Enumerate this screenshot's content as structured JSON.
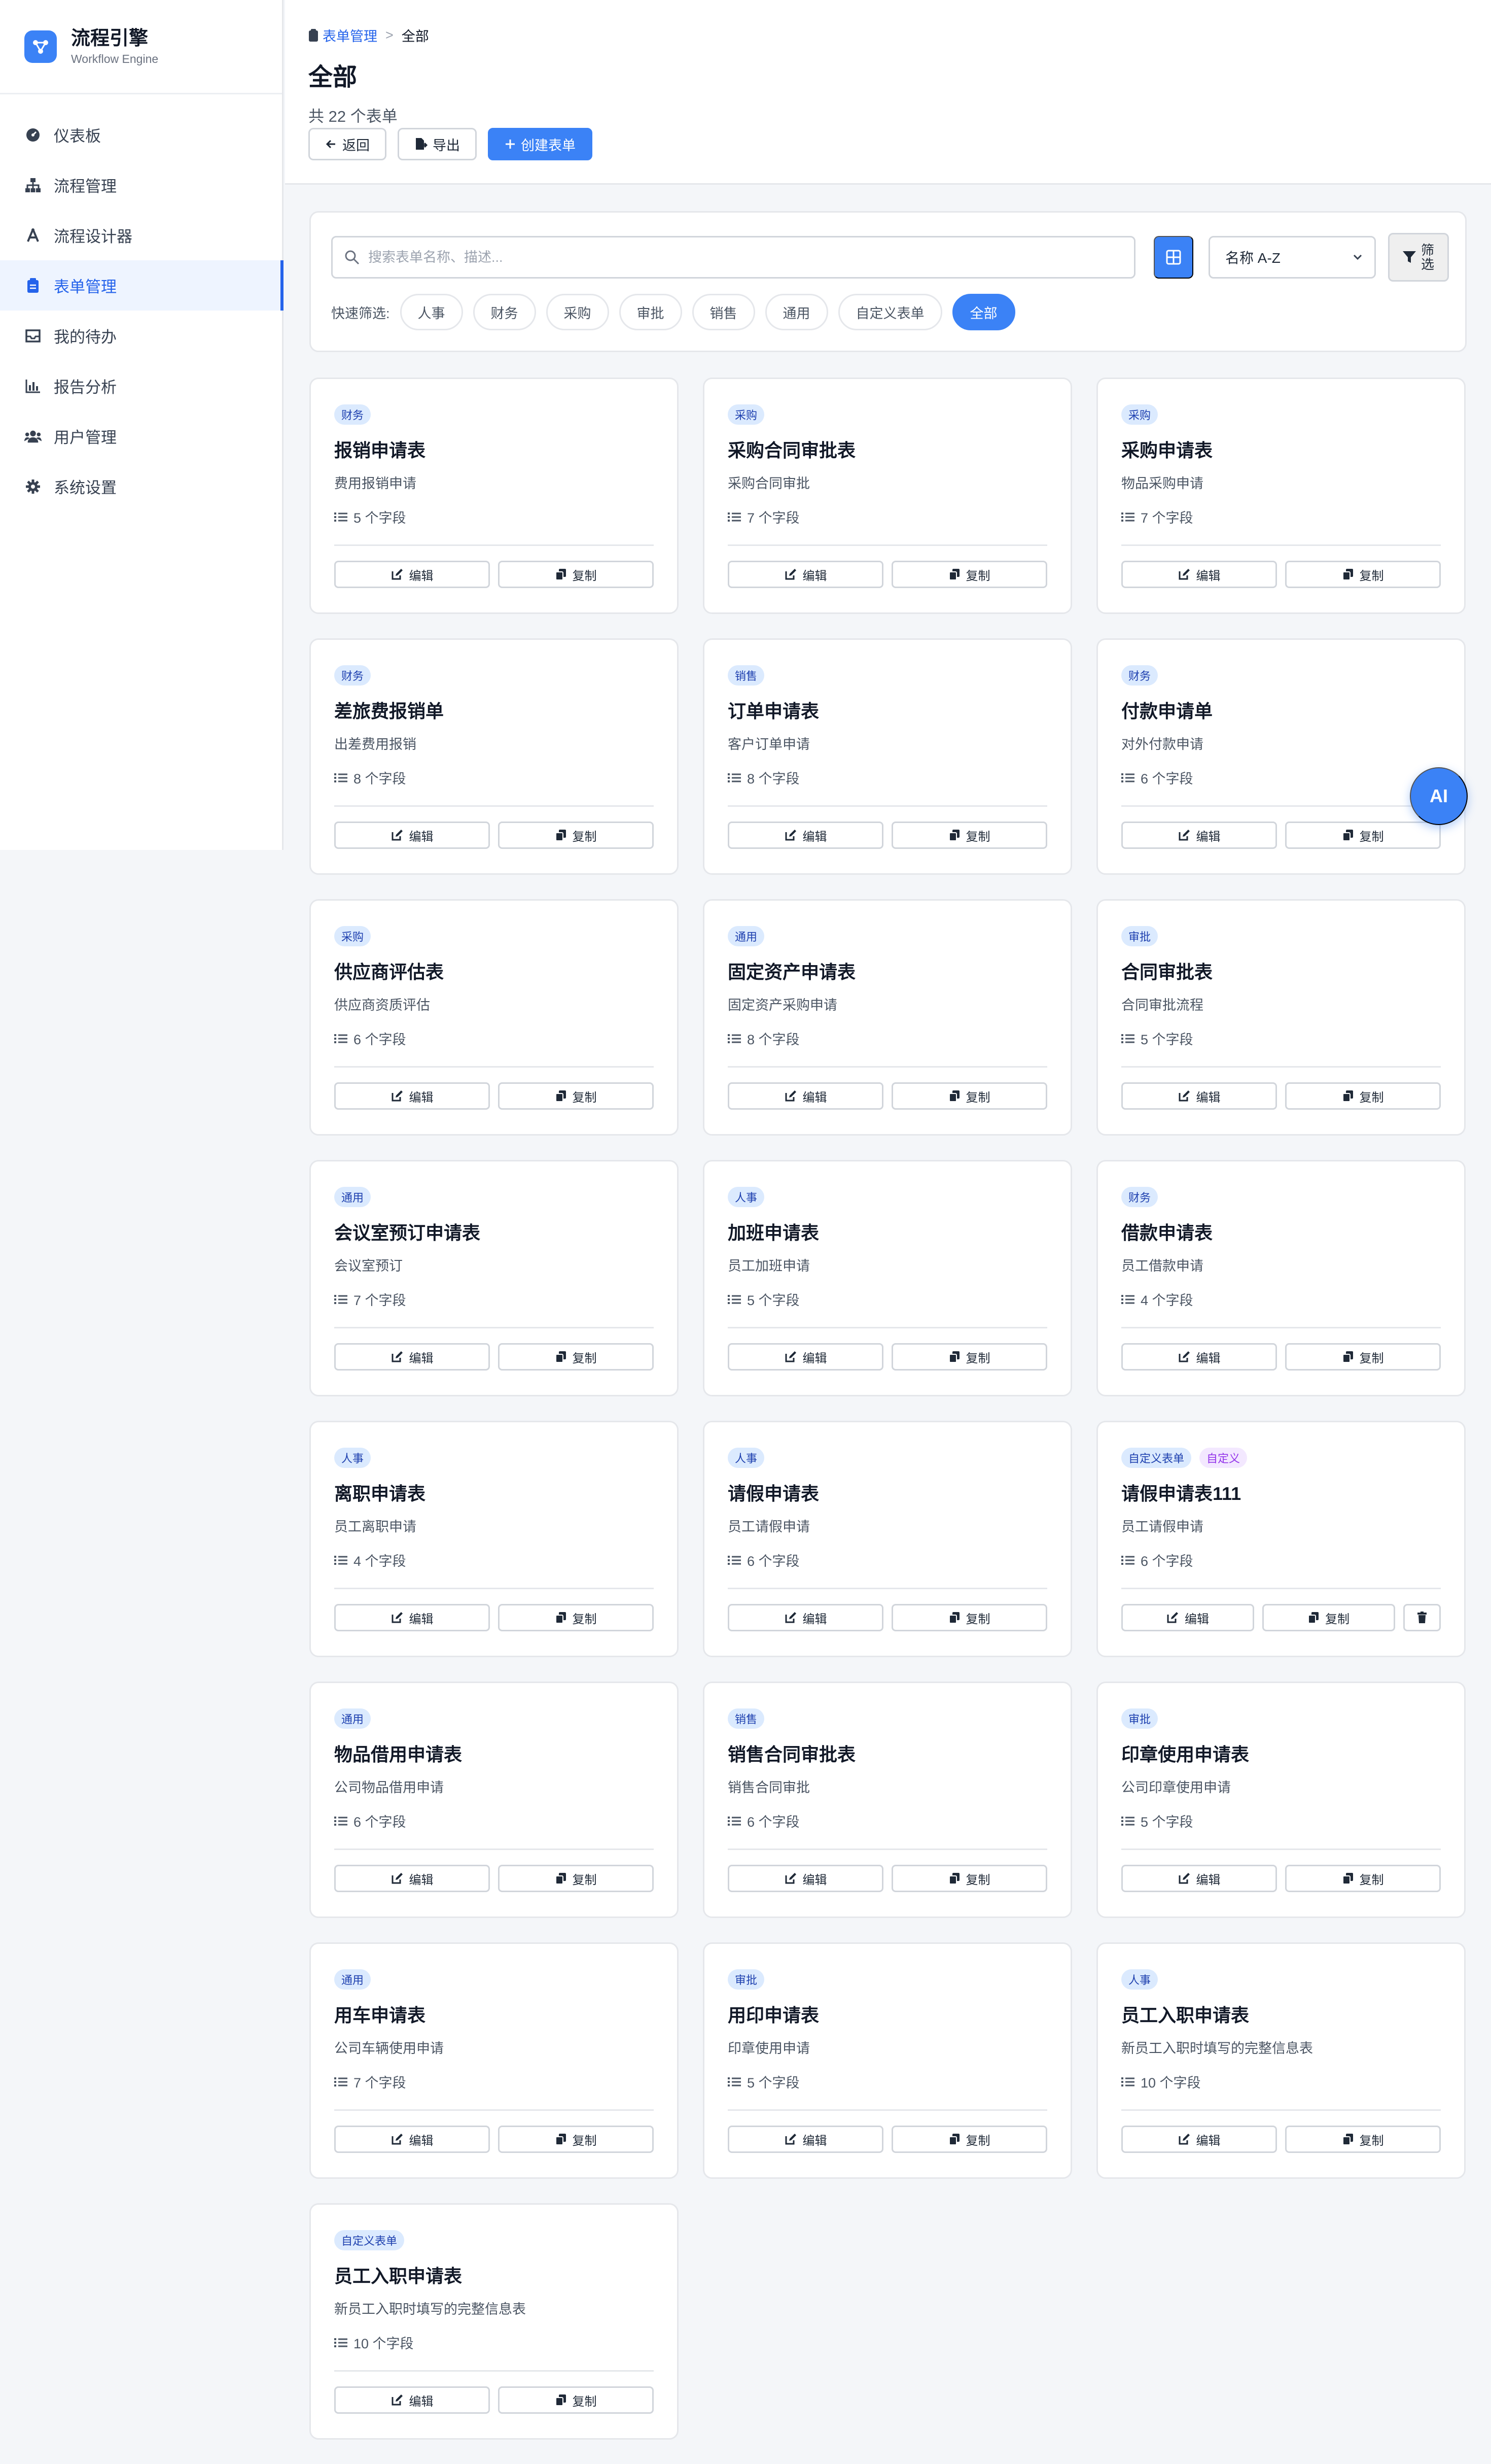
{
  "brand": {
    "title": "流程引擎",
    "subtitle": "Workflow Engine"
  },
  "sidebar": {
    "items": [
      {
        "label": "仪表板",
        "icon": "dashboard-icon"
      },
      {
        "label": "流程管理",
        "icon": "sitemap-icon"
      },
      {
        "label": "流程设计器",
        "icon": "designer-icon"
      },
      {
        "label": "表单管理",
        "icon": "clipboard-icon",
        "active": true
      },
      {
        "label": "我的待办",
        "icon": "inbox-icon"
      },
      {
        "label": "报告分析",
        "icon": "chart-icon"
      },
      {
        "label": "用户管理",
        "icon": "users-icon"
      },
      {
        "label": "系统设置",
        "icon": "gear-icon"
      }
    ]
  },
  "header": {
    "breadcrumb_link": "表单管理",
    "breadcrumb_current": "全部",
    "title": "全部",
    "count_text": "共 22 个表单",
    "back_label": "返回",
    "export_label": "导出",
    "create_label": "创建表单"
  },
  "filters": {
    "search_placeholder": "搜索表单名称、描述...",
    "sort_value": "名称 A-Z",
    "filter_label": "筛选",
    "quick_label": "快速筛选:",
    "chips": [
      "人事",
      "财务",
      "采购",
      "审批",
      "销售",
      "通用",
      "自定义表单",
      "全部"
    ],
    "active_chip": "全部"
  },
  "card_labels": {
    "edit": "编辑",
    "copy": "复制"
  },
  "forms": [
    {
      "tags": [
        "财务"
      ],
      "title": "报销申请表",
      "desc": "费用报销申请",
      "fields": "5 个字段"
    },
    {
      "tags": [
        "采购"
      ],
      "title": "采购合同审批表",
      "desc": "采购合同审批",
      "fields": "7 个字段"
    },
    {
      "tags": [
        "采购"
      ],
      "title": "采购申请表",
      "desc": "物品采购申请",
      "fields": "7 个字段"
    },
    {
      "tags": [
        "财务"
      ],
      "title": "差旅费报销单",
      "desc": "出差费用报销",
      "fields": "8 个字段"
    },
    {
      "tags": [
        "销售"
      ],
      "title": "订单申请表",
      "desc": "客户订单申请",
      "fields": "8 个字段"
    },
    {
      "tags": [
        "财务"
      ],
      "title": "付款申请单",
      "desc": "对外付款申请",
      "fields": "6 个字段"
    },
    {
      "tags": [
        "采购"
      ],
      "title": "供应商评估表",
      "desc": "供应商资质评估",
      "fields": "6 个字段"
    },
    {
      "tags": [
        "通用"
      ],
      "title": "固定资产申请表",
      "desc": "固定资产采购申请",
      "fields": "8 个字段"
    },
    {
      "tags": [
        "审批"
      ],
      "title": "合同审批表",
      "desc": "合同审批流程",
      "fields": "5 个字段"
    },
    {
      "tags": [
        "通用"
      ],
      "title": "会议室预订申请表",
      "desc": "会议室预订",
      "fields": "7 个字段"
    },
    {
      "tags": [
        "人事"
      ],
      "title": "加班申请表",
      "desc": "员工加班申请",
      "fields": "5 个字段"
    },
    {
      "tags": [
        "财务"
      ],
      "title": "借款申请表",
      "desc": "员工借款申请",
      "fields": "4 个字段"
    },
    {
      "tags": [
        "人事"
      ],
      "title": "离职申请表",
      "desc": "员工离职申请",
      "fields": "4 个字段"
    },
    {
      "tags": [
        "人事"
      ],
      "title": "请假申请表",
      "desc": "员工请假申请",
      "fields": "6 个字段"
    },
    {
      "tags": [
        "自定义表单",
        "自定义"
      ],
      "title": "请假申请表111",
      "desc": "员工请假申请",
      "fields": "6 个字段",
      "deletable": true
    },
    {
      "tags": [
        "通用"
      ],
      "title": "物品借用申请表",
      "desc": "公司物品借用申请",
      "fields": "6 个字段"
    },
    {
      "tags": [
        "销售"
      ],
      "title": "销售合同审批表",
      "desc": "销售合同审批",
      "fields": "6 个字段"
    },
    {
      "tags": [
        "审批"
      ],
      "title": "印章使用申请表",
      "desc": "公司印章使用申请",
      "fields": "5 个字段"
    },
    {
      "tags": [
        "通用"
      ],
      "title": "用车申请表",
      "desc": "公司车辆使用申请",
      "fields": "7 个字段"
    },
    {
      "tags": [
        "审批"
      ],
      "title": "用印申请表",
      "desc": "印章使用申请",
      "fields": "5 个字段"
    },
    {
      "tags": [
        "人事"
      ],
      "title": "员工入职申请表",
      "desc": "新员工入职时填写的完整信息表",
      "fields": "10 个字段"
    },
    {
      "tags": [
        "自定义表单"
      ],
      "title": "员工入职申请表",
      "desc": "新员工入职时填写的完整信息表",
      "fields": "10 个字段"
    }
  ],
  "fab": {
    "label": "AI"
  },
  "colors": {
    "accent": "#3b82f6",
    "tag_bg": "#dbeafe",
    "tag_text": "#1e40af",
    "custom_tag_bg": "#f3e8ff",
    "custom_tag_text": "#9333ea"
  }
}
